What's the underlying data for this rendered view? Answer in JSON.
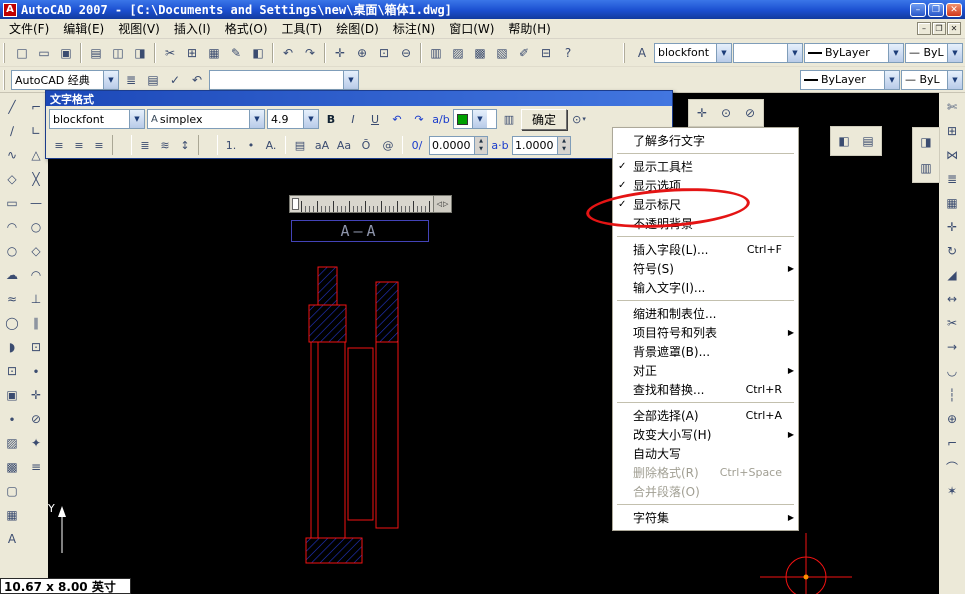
{
  "titlebar": {
    "title": "AutoCAD 2007 - [C:\\Documents and Settings\\new\\桌面\\箱体1.dwg]",
    "minimize_icon": "–",
    "restore_icon": "❐",
    "close_icon": "✕"
  },
  "menubar": {
    "items": [
      "文件(F)",
      "编辑(E)",
      "视图(V)",
      "插入(I)",
      "格式(O)",
      "工具(T)",
      "绘图(D)",
      "标注(N)",
      "窗口(W)",
      "帮助(H)"
    ],
    "mdi": {
      "minimize_icon": "–",
      "restore_icon": "❐",
      "close_icon": "✕"
    }
  },
  "toolbar1": {
    "buttons": [
      {
        "name": "new",
        "glyph": "□"
      },
      {
        "name": "open",
        "glyph": "▭"
      },
      {
        "name": "save",
        "glyph": "▣"
      },
      {
        "sep": true
      },
      {
        "name": "plot",
        "glyph": "▤"
      },
      {
        "name": "plot-preview",
        "glyph": "◫"
      },
      {
        "name": "publish",
        "glyph": "◨"
      },
      {
        "sep": true
      },
      {
        "name": "cut",
        "glyph": "✂"
      },
      {
        "name": "copy",
        "glyph": "⊞"
      },
      {
        "name": "paste",
        "glyph": "▦"
      },
      {
        "name": "match-properties",
        "glyph": "✎"
      },
      {
        "name": "block-editor",
        "glyph": "◧"
      },
      {
        "sep": true
      },
      {
        "name": "undo",
        "glyph": "↶"
      },
      {
        "name": "redo",
        "glyph": "↷"
      },
      {
        "sep": true
      },
      {
        "name": "pan",
        "glyph": "✛"
      },
      {
        "name": "zoom-realtime",
        "glyph": "⊕"
      },
      {
        "name": "zoom-window",
        "glyph": "⊡"
      },
      {
        "name": "zoom-previous",
        "glyph": "⊖"
      },
      {
        "sep": true
      },
      {
        "name": "properties",
        "glyph": "▥"
      },
      {
        "name": "designcenter",
        "glyph": "▨"
      },
      {
        "name": "tool-palettes",
        "glyph": "▩"
      },
      {
        "name": "sheet-set-manager",
        "glyph": "▧"
      },
      {
        "name": "markup",
        "glyph": "✐"
      },
      {
        "name": "quickcalc",
        "glyph": "⊟"
      },
      {
        "name": "help",
        "glyph": "?"
      }
    ],
    "spell_icon": "A",
    "style_combo": "blockfont",
    "dim_combo": "",
    "color_combo": "ByLayer",
    "linetype_combo": "— ByL"
  },
  "toolbar2": {
    "workspace_combo": "AutoCAD 经典",
    "left_buttons": [
      {
        "name": "layer-properties-manager",
        "glyph": "≣"
      },
      {
        "name": "layer-states",
        "glyph": "▤"
      },
      {
        "name": "make-object-layer-current",
        "glyph": "✓"
      },
      {
        "name": "layer-previous",
        "glyph": "↶"
      }
    ],
    "layer_combo": "",
    "color_combo": "ByLayer",
    "linetype_combo": "— ByL"
  },
  "format_dialog": {
    "title": "文字格式",
    "style_combo": "blockfont",
    "font_icon": "A",
    "font_combo": "simplex",
    "height_combo": "4.9",
    "bold_label": "B",
    "italic_label": "I",
    "underline_label": "U",
    "undo_icon": "↶",
    "redo_icon": "↷",
    "stack_icon": "a/b",
    "ruler_icon": "▥",
    "ok_label": "确定",
    "options_icon": "⊙",
    "options_arrow": "▾",
    "align_buttons": [
      {
        "name": "align-left",
        "glyph": "≡"
      },
      {
        "name": "align-center",
        "glyph": "≡"
      },
      {
        "name": "align-right",
        "glyph": "≡"
      },
      {
        "sep": true
      },
      {
        "name": "justify",
        "glyph": "≣"
      },
      {
        "name": "distribute",
        "glyph": "≋"
      },
      {
        "name": "line-spacing",
        "glyph": "↕"
      },
      {
        "sep": true
      },
      {
        "name": "numbering",
        "glyph": "1."
      },
      {
        "name": "bullets",
        "glyph": "•"
      },
      {
        "name": "uppercase-letters",
        "glyph": "A."
      }
    ],
    "field_icon": "▤",
    "uppercase_label": "aA",
    "lowercase_label": "Aa",
    "overline_label": "Ō",
    "symbol_label": "@",
    "oblique_icon": "0/",
    "oblique_value": "0.0000",
    "tracking_icon": "a·b",
    "tracking_value": "1.0000"
  },
  "context_menu": {
    "items": [
      {
        "label": "了解多行文字"
      },
      {
        "separator": true
      },
      {
        "label": "显示工具栏",
        "checked": true
      },
      {
        "label": "显示选项",
        "checked": true
      },
      {
        "label": "显示标尺",
        "checked": true
      },
      {
        "label": "不透明背景"
      },
      {
        "separator": true
      },
      {
        "label": "插入字段(L)...",
        "shortcut": "Ctrl+F"
      },
      {
        "label": "符号(S)",
        "submenu": true
      },
      {
        "label": "输入文字(I)..."
      },
      {
        "separator": true
      },
      {
        "label": "缩进和制表位..."
      },
      {
        "label": "项目符号和列表",
        "submenu": true
      },
      {
        "label": "背景遮罩(B)..."
      },
      {
        "label": "对正",
        "submenu": true
      },
      {
        "label": "查找和替换...",
        "shortcut": "Ctrl+R"
      },
      {
        "separator": true
      },
      {
        "label": "全部选择(A)",
        "shortcut": "Ctrl+A"
      },
      {
        "label": "改变大小写(H)",
        "submenu": true
      },
      {
        "label": "自动大写"
      },
      {
        "label": "删除格式(R)",
        "shortcut": "Ctrl+Space",
        "disabled": true
      },
      {
        "label": "合并段落(O)",
        "disabled": true
      },
      {
        "separator": true
      },
      {
        "label": "字符集",
        "submenu": true
      }
    ]
  },
  "left_toolbar": {
    "col1": [
      {
        "name": "line",
        "glyph": "╱"
      },
      {
        "name": "construction-line",
        "glyph": "∕"
      },
      {
        "name": "polyline",
        "glyph": "∿"
      },
      {
        "name": "polygon",
        "glyph": "◇"
      },
      {
        "name": "rectangle",
        "glyph": "▭"
      },
      {
        "name": "arc",
        "glyph": "◠"
      },
      {
        "name": "circle",
        "glyph": "○"
      },
      {
        "name": "revision-cloud",
        "glyph": "☁"
      },
      {
        "name": "spline",
        "glyph": "≈"
      },
      {
        "name": "ellipse",
        "glyph": "◯"
      },
      {
        "name": "ellipse-arc",
        "glyph": "◗"
      },
      {
        "name": "insert-block",
        "glyph": "⊡"
      },
      {
        "name": "make-block",
        "glyph": "▣"
      },
      {
        "name": "point",
        "glyph": "∙"
      },
      {
        "name": "hatch",
        "glyph": "▨"
      },
      {
        "name": "gradient",
        "glyph": "▩"
      },
      {
        "name": "region",
        "glyph": "▢"
      },
      {
        "name": "table",
        "glyph": "▦"
      },
      {
        "name": "multiline-text",
        "glyph": "A"
      }
    ],
    "col2": [
      {
        "name": "snap-from",
        "glyph": "⌐"
      },
      {
        "name": "snap-endpoint",
        "glyph": "∟"
      },
      {
        "name": "snap-midpoint",
        "glyph": "△"
      },
      {
        "name": "snap-intersection",
        "glyph": "╳"
      },
      {
        "name": "snap-extension",
        "glyph": "—"
      },
      {
        "name": "snap-center",
        "glyph": "○"
      },
      {
        "name": "snap-quadrant",
        "glyph": "◇"
      },
      {
        "name": "snap-tangent",
        "glyph": "◠"
      },
      {
        "name": "snap-perpendicular",
        "glyph": "⊥"
      },
      {
        "name": "snap-parallel",
        "glyph": "∥"
      },
      {
        "name": "snap-insert",
        "glyph": "⊡"
      },
      {
        "name": "snap-node",
        "glyph": "∙"
      },
      {
        "name": "snap-nearest",
        "glyph": "✛"
      },
      {
        "name": "snap-none",
        "glyph": "⊘"
      },
      {
        "name": "osnap-settings",
        "glyph": "✦"
      },
      {
        "name": "point-filters",
        "glyph": "≡"
      }
    ]
  },
  "right_toolbar": {
    "buttons": [
      {
        "name": "erase",
        "glyph": "✄"
      },
      {
        "name": "copy-object",
        "glyph": "⊞"
      },
      {
        "name": "mirror",
        "glyph": "⋈"
      },
      {
        "name": "offset",
        "glyph": "≣"
      },
      {
        "name": "array",
        "glyph": "▦"
      },
      {
        "name": "move",
        "glyph": "✛"
      },
      {
        "name": "rotate",
        "glyph": "↻"
      },
      {
        "name": "scale",
        "glyph": "◢"
      },
      {
        "name": "stretch",
        "glyph": "↔"
      },
      {
        "name": "trim",
        "glyph": "✂"
      },
      {
        "name": "extend",
        "glyph": "→"
      },
      {
        "name": "break-at-point",
        "glyph": "◡"
      },
      {
        "name": "break",
        "glyph": "┆"
      },
      {
        "name": "join",
        "glyph": "⊕"
      },
      {
        "name": "chamfer",
        "glyph": "⌐"
      },
      {
        "name": "fillet",
        "glyph": "⌒"
      },
      {
        "name": "explode",
        "glyph": "✶"
      }
    ]
  },
  "snap_strip": {
    "buttons": [
      {
        "name": "inquiry-distance",
        "glyph": "✛"
      },
      {
        "name": "inquiry-area",
        "glyph": "⊙"
      },
      {
        "name": "inquiry-locate-point",
        "glyph": "⊘"
      }
    ]
  },
  "float_pair": {
    "buttons": [
      {
        "name": "text-style-tool",
        "gl yph": "◧",
        "glyph": "◧"
      },
      {
        "name": "table-style-tool",
        "glyph": "▤"
      }
    ]
  },
  "right_frag": {
    "buttons": [
      {
        "name": "dim-style-tool",
        "glyph": "◨"
      },
      {
        "name": "multiline-style-tool",
        "glyph": "▥"
      }
    ]
  },
  "drawing": {
    "mtext_value": "A—A",
    "ruler_left_icon": "◁",
    "ruler_right_icon": "▷",
    "ucs_label": "Y",
    "status_text": "10.67 x 8.00 英寸"
  }
}
